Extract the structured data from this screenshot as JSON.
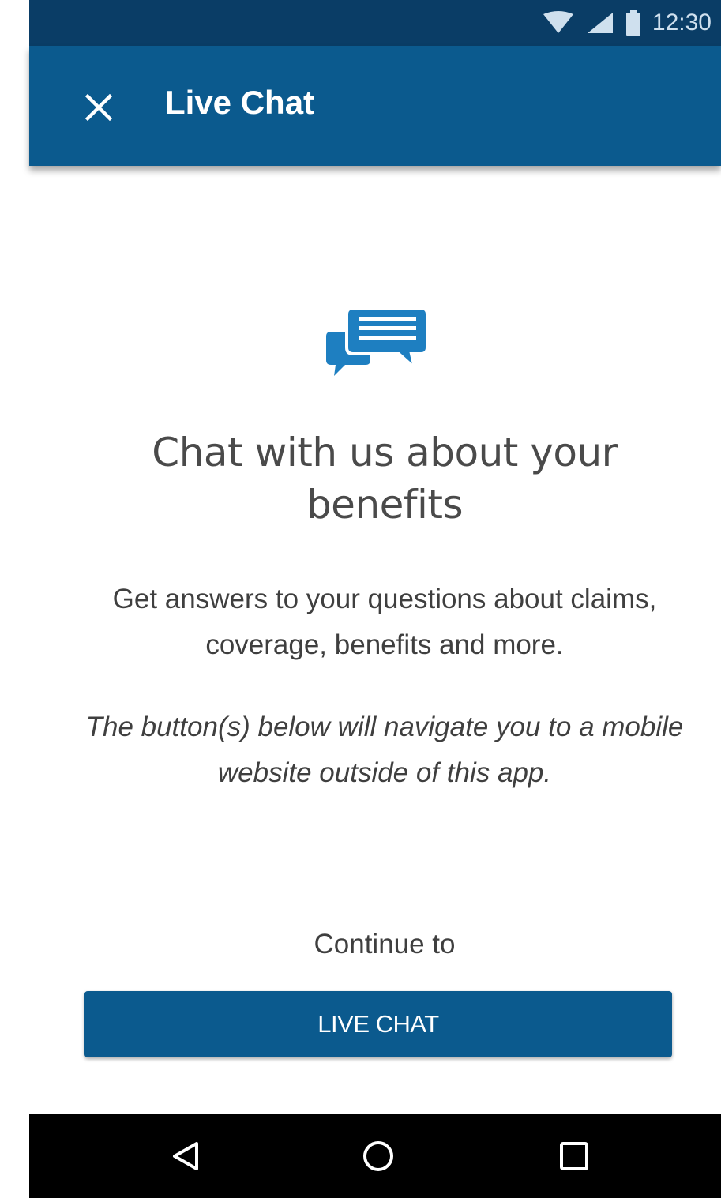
{
  "status_bar": {
    "time": "12:30",
    "icons": [
      "wifi-icon",
      "signal-icon",
      "battery-icon"
    ]
  },
  "app_bar": {
    "title": "Live Chat",
    "close_icon": "close-icon"
  },
  "content": {
    "illustration_icon": "chat-bubbles-icon",
    "headline": "Chat with us about your benefits",
    "description": "Get answers to your questions about claims, coverage, benefits and more.",
    "disclaimer": "The button(s) below will navigate you to a mobile website outside of this app.",
    "continue_label": "Continue to",
    "button_label": "LIVE CHAT"
  },
  "nav_bar": {
    "icons": [
      "back-icon",
      "home-icon",
      "recents-icon"
    ]
  },
  "colors": {
    "status_bar": "#0a3d66",
    "app_bar": "#0b5a8e",
    "accent_icon": "#1e7fc1",
    "button": "#0b5a8e",
    "nav_bar": "#000000"
  }
}
